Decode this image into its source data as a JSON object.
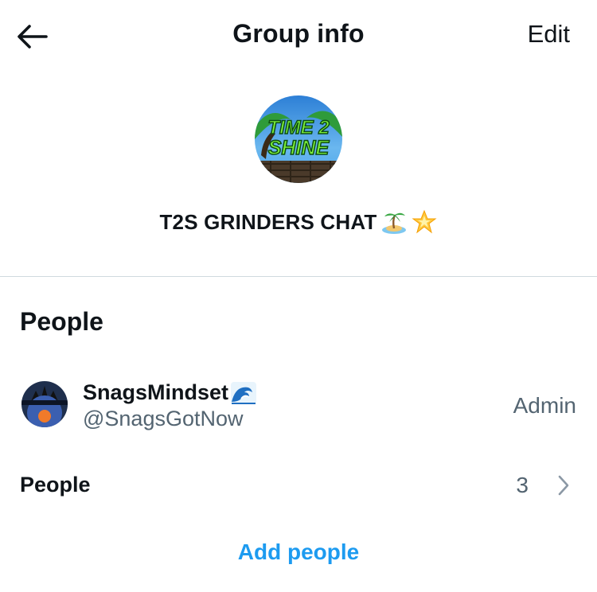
{
  "header": {
    "title": "Group info",
    "edit_label": "Edit",
    "back_icon": "arrow-left-icon"
  },
  "group": {
    "avatar_text_line1": "TIME 2",
    "avatar_text_line2": "SHINE",
    "name": "T2S GRINDERS CHAT",
    "name_emojis": [
      "island-icon",
      "star-icon"
    ]
  },
  "people_section": {
    "title": "People",
    "members": [
      {
        "display_name": "SnagsMindset",
        "name_emoji": "wave-icon",
        "handle": "@SnagsGotNow",
        "role": "Admin"
      }
    ],
    "people_row": {
      "label": "People",
      "count": "3"
    },
    "add_people_label": "Add people"
  },
  "colors": {
    "text_primary": "#0f1419",
    "text_secondary": "#536471",
    "accent": "#1d9bf0",
    "divider": "#cfd9de"
  }
}
